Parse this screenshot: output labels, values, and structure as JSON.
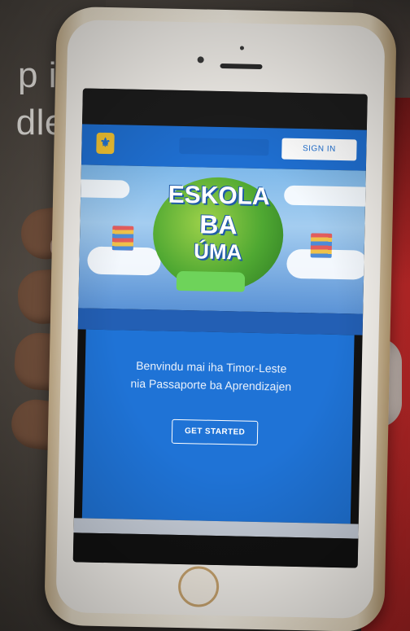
{
  "overlay": {
    "line1": "p in",
    "line2": "dle-"
  },
  "app": {
    "header": {
      "sign_in_label": "SIGN IN",
      "logo_icon": "emblem-icon"
    },
    "hero": {
      "title_line1": "ESKOLA",
      "title_line2": "BA",
      "title_line3": "ÚMA"
    },
    "welcome": {
      "line1": "Benvindu mai iha Timor-Leste",
      "line2": "nia Passaporte ba Aprendizajen"
    },
    "cta_label": "GET STARTED"
  },
  "colors": {
    "primary_blue": "#1f73d6",
    "sign_in_text": "#1f6fd1",
    "phone_case": "#efe5d1",
    "shirt_red": "#c42a2a"
  }
}
